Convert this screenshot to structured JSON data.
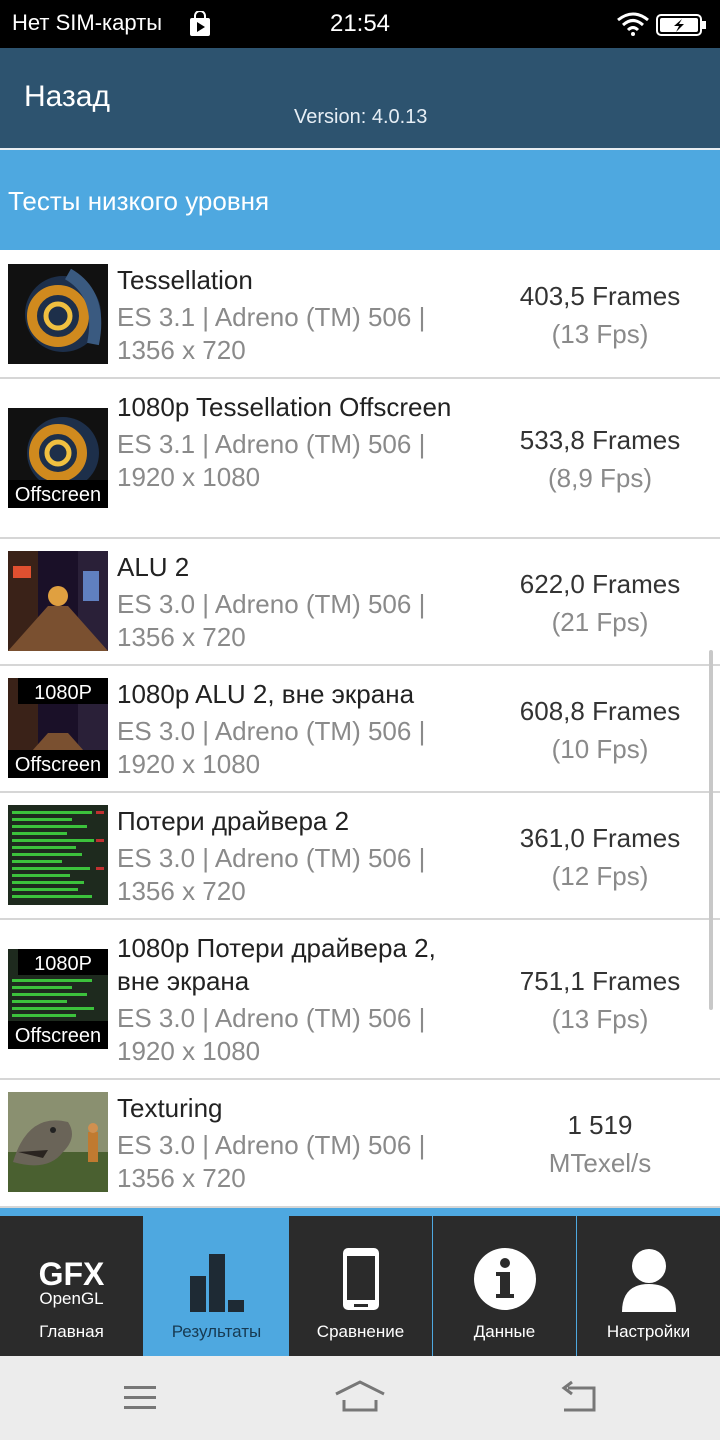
{
  "status_bar": {
    "carrier": "Нет SIM-карты",
    "time": "21:54",
    "icons": [
      "shopping-bag-icon",
      "wifi-icon",
      "battery-charging-icon"
    ]
  },
  "header": {
    "back_label": "Назад",
    "version": "Version: 4.0.13"
  },
  "section": {
    "title": "Тесты низкого уровня"
  },
  "tests": [
    {
      "name": "Tessellation",
      "api": "ES 3.1 | Adreno (TM) 506 |",
      "resolution": "1356 x 720",
      "result": "403,5 Frames",
      "secondary": "(13 Fps)",
      "thumb_overlay": ""
    },
    {
      "name": "1080p Tessellation Offscreen",
      "api": "ES 3.1 | Adreno (TM) 506 |",
      "resolution": "1920 x 1080",
      "result": "533,8 Frames",
      "secondary": "(8,9 Fps)",
      "thumb_overlay": "Offscreen"
    },
    {
      "name": "ALU 2",
      "api": "ES 3.0 | Adreno (TM) 506 |",
      "resolution": "1356 x 720",
      "result": "622,0 Frames",
      "secondary": "(21 Fps)",
      "thumb_overlay": ""
    },
    {
      "name": "1080p ALU 2, вне экрана",
      "api": "ES 3.0 | Adreno (TM) 506 |",
      "resolution": "1920 x 1080",
      "result": "608,8 Frames",
      "secondary": "(10 Fps)",
      "thumb_top": "1080P",
      "thumb_overlay": "Offscreen"
    },
    {
      "name": "Потери драйвера 2",
      "api": "ES 3.0 | Adreno (TM) 506 |",
      "resolution": "1356 x 720",
      "result": "361,0 Frames",
      "secondary": "(12 Fps)",
      "thumb_overlay": ""
    },
    {
      "name": "1080p Потери драйвера 2, вне экрана",
      "api": "ES 3.0 | Adreno (TM) 506 |",
      "resolution": "1920 x 1080",
      "result": "751,1 Frames",
      "secondary": "(13 Fps)",
      "thumb_top": "1080P",
      "thumb_overlay": "Offscreen"
    },
    {
      "name": "Texturing",
      "api": "ES 3.0 | Adreno (TM) 506 |",
      "resolution": "1356 x 720",
      "result": "1 519",
      "secondary": "MTexel/s",
      "thumb_overlay": ""
    }
  ],
  "tabs": [
    {
      "label": "Главная",
      "icon": "gfx-opengl-logo-icon",
      "logo_top": "GFX",
      "logo_bottom": "OpenGL",
      "active": false
    },
    {
      "label": "Результаты",
      "icon": "bar-chart-icon",
      "active": true
    },
    {
      "label": "Сравнение",
      "icon": "phone-icon",
      "active": false
    },
    {
      "label": "Данные",
      "icon": "info-icon",
      "active": false
    },
    {
      "label": "Настройки",
      "icon": "user-icon",
      "active": false
    }
  ],
  "navbar": {
    "icons": [
      "menu-icon",
      "home-icon",
      "back-icon"
    ]
  },
  "colors": {
    "header": "#2d536f",
    "accent": "#4ea8e0",
    "tab_bg": "#2b2b2b"
  }
}
